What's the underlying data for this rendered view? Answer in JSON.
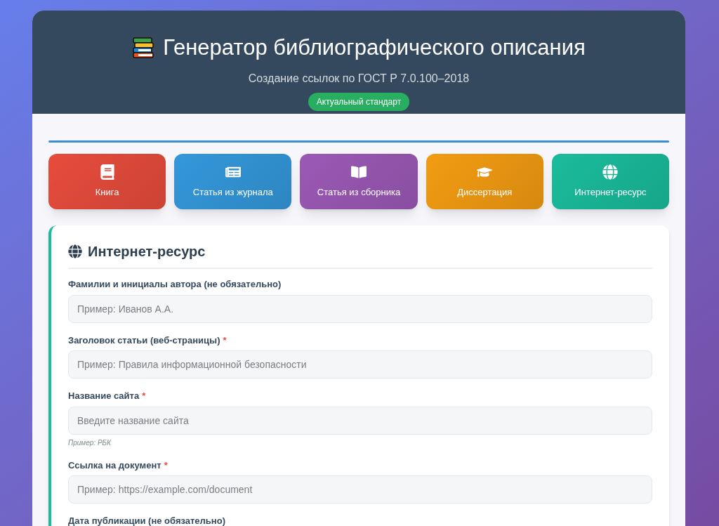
{
  "header": {
    "title": "Генератор библиографического описания",
    "subtitle": "Создание ссылок по ГОСТ Р 7.0.100–2018",
    "badge": "Актуальный стандарт"
  },
  "types": [
    {
      "kind": "book",
      "label": "Книга",
      "color": "#e74c3c"
    },
    {
      "kind": "journal",
      "label": "Статья из журнала",
      "color": "#3498db"
    },
    {
      "kind": "collection",
      "label": "Статья из сборника",
      "color": "#9b59b6"
    },
    {
      "kind": "thesis",
      "label": "Диссертация",
      "color": "#f39c12"
    },
    {
      "kind": "web",
      "label": "Интернет-ресурс",
      "color": "#1abc9c"
    }
  ],
  "form": {
    "title": "Интернет-ресурс",
    "fields": [
      {
        "label": "Фамилии и инициалы автора (не обязательно)",
        "placeholder": "Пример: Иванов А.А."
      },
      {
        "label": "Заголовок статьи (веб-страницы)",
        "required_mark": "*",
        "placeholder": "Пример: Правила информационной безопасности"
      },
      {
        "label": "Название сайта",
        "required_mark": "*",
        "placeholder": "Введите название сайта",
        "hint": "Пример: РБК"
      },
      {
        "label": "Ссылка на документ",
        "required_mark": "*",
        "placeholder": "Пример: https://example.com/document"
      },
      {
        "label": "Дата публикации (не обязательно)"
      }
    ]
  }
}
